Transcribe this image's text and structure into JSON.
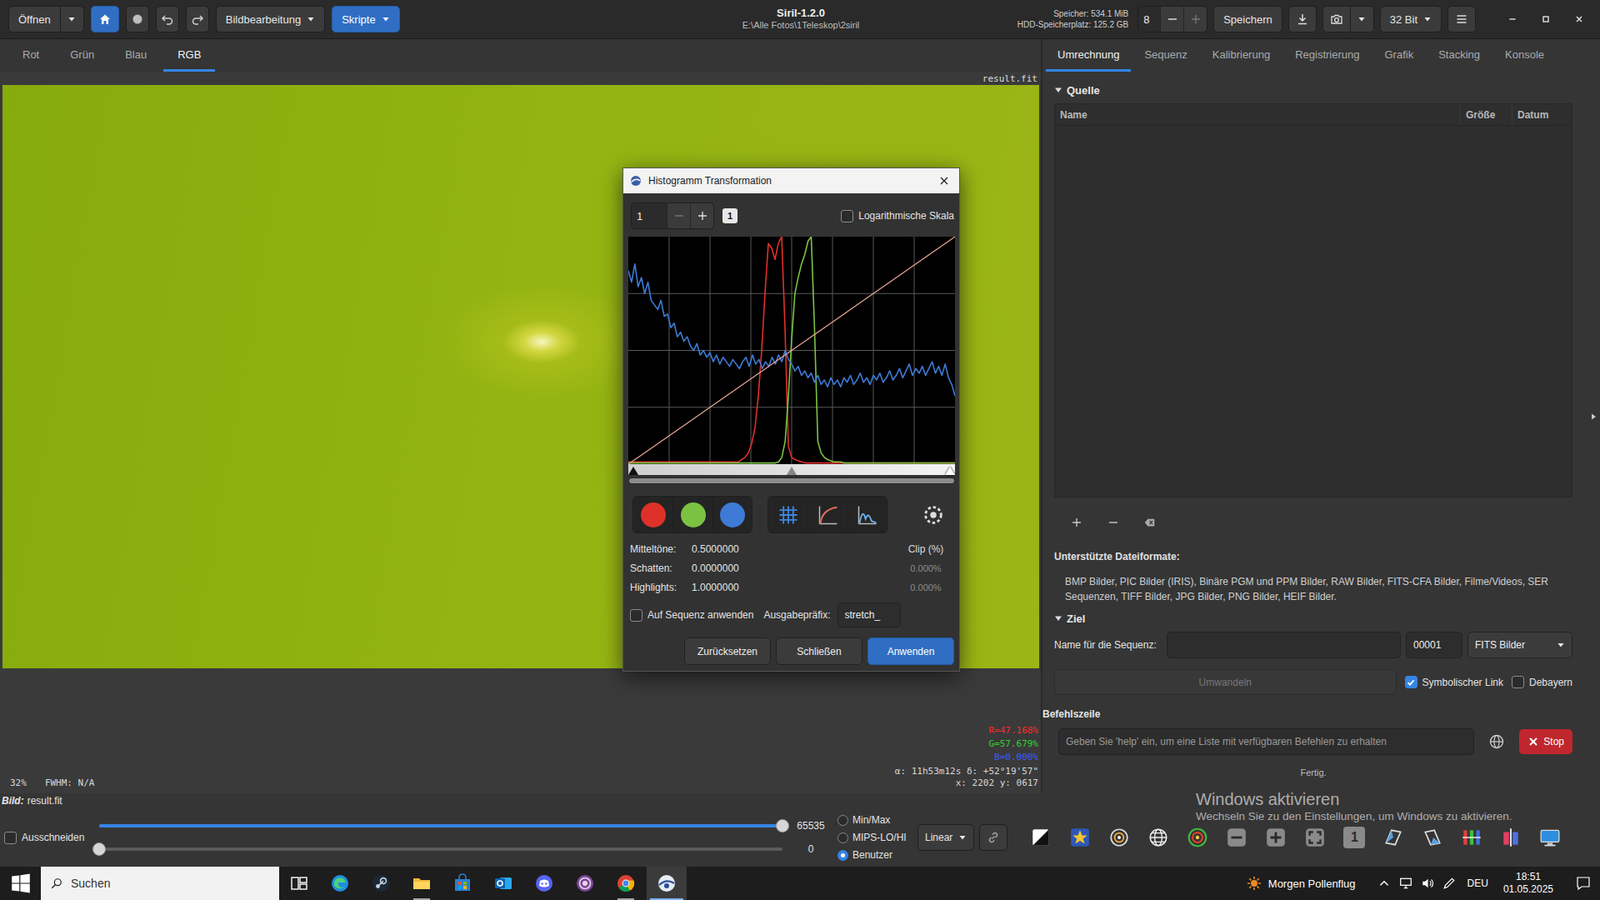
{
  "window": {
    "title": "Siril-1.2.0",
    "path": "E:\\Alle Fotos\\1Teleskop\\2siril"
  },
  "toolbar": {
    "open_label": "Öffnen",
    "home_selected": true,
    "menus": [
      {
        "label": "Bildbearbeitung",
        "selected": false
      },
      {
        "label": "Skripte",
        "selected": true
      }
    ],
    "memory": "Speicher: 534.1 MiB",
    "disk": "HDD-Speicherplatz: 125.2 GB",
    "threads": "8",
    "threads_plus_disabled": true,
    "save_label": "Speichern",
    "bit_depth": "32 Bit"
  },
  "view_tabs": [
    {
      "label": "Rot",
      "selected": false
    },
    {
      "label": "Grün",
      "selected": false
    },
    {
      "label": "Blau",
      "selected": false
    },
    {
      "label": "RGB",
      "selected": true
    }
  ],
  "viewer": {
    "filename": "result.fit",
    "zoom": "32%",
    "fwhm": "FWHM: N/A",
    "readouts": [
      {
        "text": "R=47.168%",
        "color": "#ff2a2a"
      },
      {
        "text": "G=57.679%",
        "color": "#2fd62f"
      },
      {
        "text": "B=0.000%",
        "color": "#3a5bff"
      }
    ],
    "coords": "α: 11h53m12s δ: +52°19'57\"",
    "pixel": "x: 2202 y: 0617"
  },
  "right_panel": {
    "tabs": [
      {
        "label": "Umrechnung",
        "selected": true
      },
      {
        "label": "Sequenz",
        "selected": false
      },
      {
        "label": "Kalibrierung",
        "selected": false
      },
      {
        "label": "Registrierung",
        "selected": false
      },
      {
        "label": "Grafik",
        "selected": false
      },
      {
        "label": "Stacking",
        "selected": false
      },
      {
        "label": "Konsole",
        "selected": false
      }
    ],
    "source": {
      "header": "Quelle",
      "expanded": true,
      "columns": [
        "Name",
        "Größe",
        "Datum"
      ],
      "rows": []
    },
    "formats_label": "Unterstützte Dateiformate:",
    "formats": "BMP Bilder, PIC Bilder (IRIS), Binäre PGM und PPM Bilder, RAW Bilder, FITS-CFA Bilder, Filme/Videos, SER Sequenzen, TIFF Bilder, JPG Bilder, PNG Bilder, HEIF Bilder.",
    "target": {
      "header": "Ziel",
      "expanded": true,
      "name_label": "Name für die Sequenz:",
      "name_value": "",
      "start_index": "00001",
      "format": "FITS Bilder",
      "convert_label": "Umwandeln",
      "convert_disabled": true,
      "options": [
        {
          "label": "Symbolischer Link",
          "checked": true
        },
        {
          "label": "Debayern",
          "checked": false
        }
      ]
    },
    "command": {
      "label": "Befehlszeile",
      "placeholder": "Geben Sie 'help' ein, um eine Liste mit verfügbaren Befehlen zu erhalten",
      "stop_label": "Stop"
    },
    "status": "Fertig."
  },
  "bottom": {
    "image_label": "Bild:",
    "image_name": "result.fit",
    "crop": {
      "label": "Ausschneiden",
      "checked": false
    },
    "sliders": [
      {
        "level": 1,
        "value": "65535"
      },
      {
        "level": 0,
        "value": "0"
      }
    ],
    "modes": [
      {
        "label": "Min/Max",
        "selected": false
      },
      {
        "label": "MIPS-LO/HI",
        "selected": false
      },
      {
        "label": "Benutzer",
        "selected": true
      }
    ],
    "scale": "Linear",
    "tools": [
      {
        "kind": "negative"
      },
      {
        "kind": "colormap"
      },
      {
        "kind": "galaxy"
      },
      {
        "kind": "globe"
      },
      {
        "kind": "photometry"
      },
      {
        "kind": "zoom-out"
      },
      {
        "kind": "zoom-in"
      },
      {
        "kind": "zoom-fit"
      },
      {
        "kind": "zoom-one",
        "label": "1"
      },
      {
        "kind": "mirror-x"
      },
      {
        "kind": "mirror-y"
      },
      {
        "kind": "rgb-align"
      },
      {
        "kind": "split"
      },
      {
        "kind": "display"
      }
    ]
  },
  "watermark": {
    "title": "Windows aktivieren",
    "text": "Wechseln Sie zu den Einstellungen, um Windows zu aktivieren."
  },
  "taskbar": {
    "search_placeholder": "Suchen",
    "apps": [
      {
        "kind": "task-view",
        "running": false,
        "selected": false
      },
      {
        "kind": "edge",
        "running": false,
        "selected": false
      },
      {
        "kind": "steam",
        "running": false,
        "selected": false
      },
      {
        "kind": "explorer",
        "running": true,
        "selected": false
      },
      {
        "kind": "store",
        "running": false,
        "selected": false
      },
      {
        "kind": "outlook",
        "running": false,
        "selected": false
      },
      {
        "kind": "discord",
        "running": false,
        "selected": false
      },
      {
        "kind": "purple-browser",
        "running": false,
        "selected": false
      },
      {
        "kind": "chrome",
        "running": true,
        "selected": false
      },
      {
        "kind": "siril",
        "running": true,
        "selected": true
      }
    ],
    "weather": "Morgen Pollenflug",
    "language": "DEU",
    "time": "18:51",
    "date": "01.05.2025"
  },
  "dialog": {
    "title": "Histogramm Transformation",
    "zoom": {
      "value": "1",
      "badge": "1"
    },
    "log_scale": {
      "label": "Logarithmische Skala",
      "checked": false
    },
    "channels": [
      {
        "color": "#e0302a",
        "on": true,
        "values": [
          1,
          1,
          1,
          1,
          1,
          1,
          1,
          1,
          1,
          1,
          1,
          1,
          1,
          1,
          1,
          1,
          1,
          1,
          1,
          1,
          1,
          1,
          1,
          1,
          1,
          1,
          1,
          1,
          1,
          1,
          1,
          1,
          1,
          1,
          2,
          3,
          5,
          9,
          16,
          30,
          50,
          75,
          97,
          95,
          90,
          97,
          100,
          60,
          8,
          3,
          2,
          1.5,
          1,
          0.5,
          0.5,
          0.5,
          0.5,
          0.5,
          0.5,
          0.5,
          0.5,
          0.5,
          0.5,
          0.5,
          0.5,
          0.5,
          0.5,
          0.5,
          0.5,
          0.5,
          0.5,
          0.5,
          0.5,
          0.5,
          0.5,
          0.5,
          0.5,
          0.5,
          0.5,
          0.5,
          0.5,
          0.5,
          0.5,
          0.5,
          0.5,
          0.5,
          0.5,
          0.5,
          0.5,
          0.5,
          0.5,
          0.5,
          0.5,
          0.5,
          0.5,
          0.5,
          0.5,
          0.5,
          0.5
        ]
      },
      {
        "color": "#7cc242",
        "on": true,
        "values": [
          0.5,
          0.5,
          0.5,
          0.5,
          0.5,
          0.5,
          0.5,
          0.5,
          0.5,
          0.5,
          0.5,
          0.5,
          0.5,
          0.5,
          0.5,
          0.5,
          0.5,
          0.5,
          0.5,
          0.5,
          0.5,
          0.5,
          0.5,
          0.5,
          0.5,
          0.5,
          0.5,
          0.5,
          0.5,
          0.5,
          0.5,
          0.5,
          0.5,
          0.5,
          0.5,
          0.5,
          0.5,
          0.5,
          0.5,
          0.5,
          0.5,
          0.5,
          0.5,
          0.5,
          0.5,
          0.5,
          1,
          3,
          10,
          30,
          55,
          75,
          82,
          88,
          92,
          98,
          100,
          60,
          10,
          5,
          3,
          2,
          1.5,
          1,
          1,
          1,
          0.5,
          0.5,
          0.5,
          0.5,
          0.5,
          0.5,
          0.5,
          0.5,
          0.5,
          0.5,
          0.5,
          0.5,
          0.5,
          0.5,
          0.5,
          0.5,
          0.5,
          0.5,
          0.5,
          0.5,
          0.5,
          0.5,
          0.5,
          0.5,
          0.5,
          0.5,
          0.5,
          0.5,
          0.5,
          0.5,
          0.5,
          0.5,
          0.5,
          0.5,
          0.5
        ]
      },
      {
        "color": "#3d7bd6",
        "on": true,
        "values": [
          85,
          80,
          88,
          78,
          82,
          75,
          80,
          72,
          70,
          68,
          72,
          65,
          66,
          60,
          62,
          56,
          58,
          54,
          56,
          52,
          50,
          53,
          48,
          50,
          47,
          49,
          45,
          48,
          44,
          47,
          45,
          43,
          46,
          44,
          42,
          45,
          47,
          43,
          48,
          44,
          46,
          42,
          45,
          43,
          47,
          44,
          48,
          45,
          50,
          46,
          44,
          41,
          43,
          39,
          41,
          38,
          40,
          36,
          39,
          35,
          37,
          34,
          38,
          35,
          37,
          34,
          38,
          36,
          39,
          35,
          37,
          40,
          36,
          38,
          35,
          39,
          37,
          40,
          36,
          38,
          41,
          37,
          39,
          42,
          38,
          41,
          44,
          39,
          42,
          40,
          43,
          39,
          42,
          45,
          40,
          43,
          39,
          44,
          38,
          35,
          30
        ]
      }
    ],
    "curve": [
      0,
      25,
      50,
      75,
      100
    ],
    "toggles": [
      {
        "kind": "grid",
        "on": true
      },
      {
        "kind": "curve",
        "on": true
      },
      {
        "kind": "histogram",
        "on": true
      }
    ],
    "handles": [
      {
        "kind": "shadows",
        "level": 0
      },
      {
        "kind": "midtones",
        "level": 0.5
      },
      {
        "kind": "highlights",
        "level": 1
      }
    ],
    "fields": [
      {
        "label": "Mitteltöne:",
        "value": "0.5000000"
      },
      {
        "label": "Schatten:",
        "value": "0.0000000"
      },
      {
        "label": "Highlights:",
        "value": "1.0000000"
      }
    ],
    "clip": {
      "label": "Clip (%)",
      "values": [
        "0.000%",
        "0.000%"
      ]
    },
    "apply_sequence": {
      "label": "Auf Sequenz anwenden",
      "checked": false
    },
    "prefix": {
      "label": "Ausgabepräfix:",
      "value": "stretch_"
    },
    "buttons": [
      {
        "label": "Zurücksetzen",
        "primary": false
      },
      {
        "label": "Schließen",
        "primary": false
      },
      {
        "label": "Anwenden",
        "primary": true
      }
    ]
  }
}
